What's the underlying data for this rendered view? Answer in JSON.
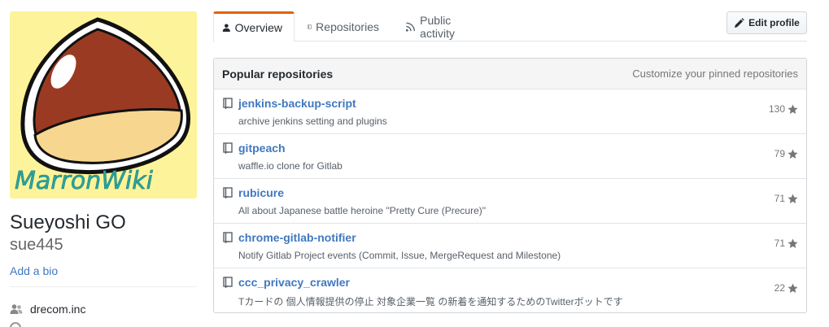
{
  "profile": {
    "fullname": "Sueyoshi GO",
    "username": "sue445",
    "bio_link": "Add a bio",
    "organization": "drecom.inc"
  },
  "avatar": {
    "caption": "MarronWiki"
  },
  "tabs": [
    {
      "label": "Overview",
      "icon": "person-icon",
      "selected": true
    },
    {
      "label": "Repositories",
      "icon": "repo-book-icon",
      "selected": false
    },
    {
      "label": "Public activity",
      "icon": "rss-icon",
      "selected": false
    }
  ],
  "edit_profile_label": "Edit profile",
  "pinned": {
    "title": "Popular repositories",
    "customize_label": "Customize your pinned repositories",
    "repos": [
      {
        "name": "jenkins-backup-script",
        "description": "archive jenkins setting and plugins",
        "stars": "130"
      },
      {
        "name": "gitpeach",
        "description": "waffle.io clone for Gitlab",
        "stars": "79"
      },
      {
        "name": "rubicure",
        "description": "All about Japanese battle heroine \"Pretty Cure (Precure)\"",
        "stars": "71"
      },
      {
        "name": "chrome-gitlab-notifier",
        "description": "Notify Gitlab Project events (Commit, Issue, MergeRequest and Milestone)",
        "stars": "71"
      },
      {
        "name": "ccc_privacy_crawler",
        "description": "Tカードの 個人情報提供の停止 対象企業一覧 の新着を通知するためのTwitterボットです",
        "stars": "22"
      }
    ]
  },
  "colors": {
    "link": "#4078c0",
    "tab_accent": "#e36209",
    "avatar_bg": "#fdf39a",
    "chestnut_brown": "#9b3a22",
    "chestnut_base": "#f7d68f"
  }
}
